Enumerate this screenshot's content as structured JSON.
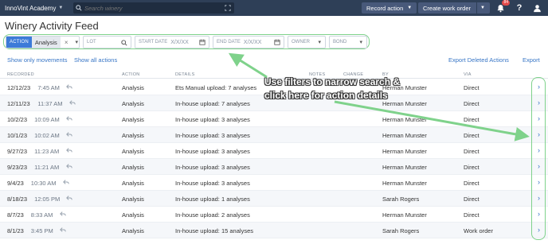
{
  "topbar": {
    "brand": "InnoVint Academy",
    "search_placeholder": "Search winery",
    "record_action": "Record action",
    "create_work_order": "Create work order",
    "notification_count": "84"
  },
  "page_title": "Winery Activity Feed",
  "filters": {
    "action_tag": "ACTION",
    "action_value": "Analysis",
    "lot_label": "LOT",
    "start_date_label": "START DATE",
    "start_date_placeholder": "X/X/XX",
    "end_date_label": "END DATE",
    "end_date_placeholder": "X/X/XX",
    "owner_label": "OWNER",
    "bond_label": "BOND"
  },
  "links": {
    "show_only_movements": "Show only movements",
    "show_all_actions": "Show all actions",
    "export_deleted": "Export Deleted Actions",
    "export": "Export"
  },
  "columns": {
    "recorded": "RECORDED",
    "action": "ACTION",
    "details": "DETAILS",
    "notes": "NOTES",
    "change": "CHANGE",
    "by": "BY",
    "via": "VIA"
  },
  "rows": [
    {
      "date": "12/12/23",
      "time": "7:45 AM",
      "action": "Analysis",
      "details": "Ets Manual upload: 7 analyses",
      "by": "Herman Munster",
      "via": "Direct"
    },
    {
      "date": "12/11/23",
      "time": "11:37 AM",
      "action": "Analysis",
      "details": "In-house upload: 7 analyses",
      "by": "Herman Munster",
      "via": "Direct"
    },
    {
      "date": "10/2/23",
      "time": "10:09 AM",
      "action": "Analysis",
      "details": "In-house upload: 3 analyses",
      "by": "Herman Munster",
      "via": "Direct"
    },
    {
      "date": "10/1/23",
      "time": "10:02 AM",
      "action": "Analysis",
      "details": "In-house upload: 3 analyses",
      "by": "Herman Munster",
      "via": "Direct"
    },
    {
      "date": "9/27/23",
      "time": "11:23 AM",
      "action": "Analysis",
      "details": "In-house upload: 3 analyses",
      "by": "Herman Munster",
      "via": "Direct"
    },
    {
      "date": "9/23/23",
      "time": "11:21 AM",
      "action": "Analysis",
      "details": "In-house upload: 3 analyses",
      "by": "Herman Munster",
      "via": "Direct"
    },
    {
      "date": "9/4/23",
      "time": "10:30 AM",
      "action": "Analysis",
      "details": "In-house upload: 3 analyses",
      "by": "Herman Munster",
      "via": "Direct"
    },
    {
      "date": "8/18/23",
      "time": "12:05 PM",
      "action": "Analysis",
      "details": "In-house upload: 1 analyses",
      "by": "Sarah Rogers",
      "via": "Direct"
    },
    {
      "date": "8/7/23",
      "time": "8:33 AM",
      "action": "Analysis",
      "details": "In-house upload: 2 analyses",
      "by": "Herman Munster",
      "via": "Direct"
    },
    {
      "date": "8/1/23",
      "time": "3:45 PM",
      "action": "Analysis",
      "details": "In-house upload: 15 analyses",
      "by": "Sarah Rogers",
      "via": "Work order"
    }
  ],
  "annotation": {
    "line1": "Use filters to narrow search &",
    "line2": "click here for action details"
  },
  "colors": {
    "topbar": "#2e3f57",
    "link": "#3876c6",
    "highlight": "#7fd28b",
    "action_tag": "#3c7bd8"
  }
}
